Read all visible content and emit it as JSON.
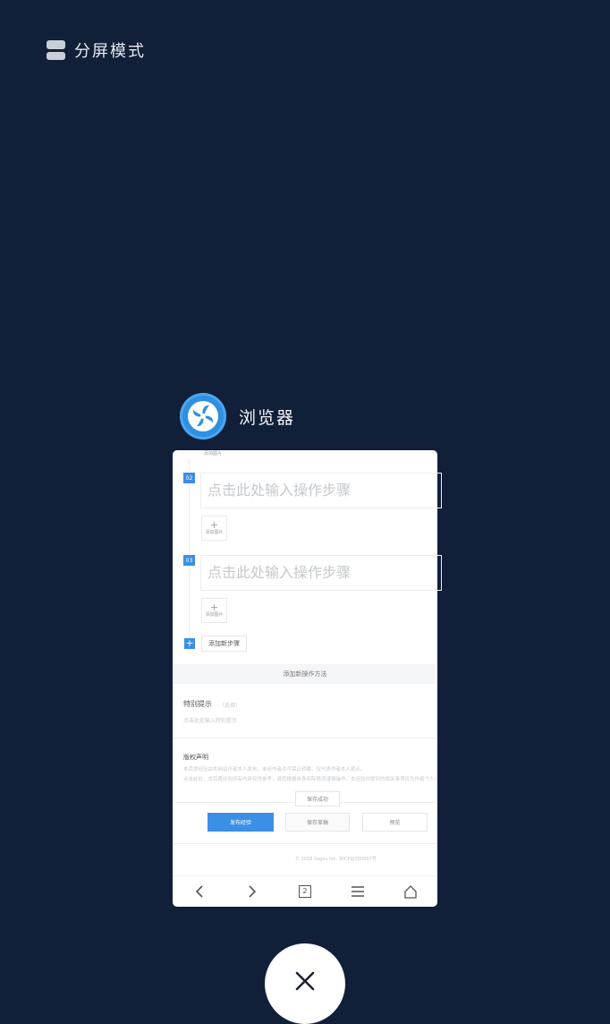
{
  "split_mode": {
    "label": "分屏模式",
    "icon": "split-screen-icon"
  },
  "app": {
    "name": "浏览器",
    "icon": "browser-fan-icon",
    "accent": "#2f8fe0"
  },
  "card": {
    "top_add_image": "添加图片",
    "steps": [
      {
        "number": "02",
        "placeholder": "点击此处输入操作步骤",
        "add_image": "添加图片"
      },
      {
        "number": "03",
        "placeholder": "点击此处输入操作步骤",
        "add_image": "添加图片"
      }
    ],
    "add_step_label": "添加新步骤",
    "add_method_label": "添加新操作方法",
    "tips": {
      "title": "特别提示",
      "note": "（选填）",
      "placeholder": "点击此处输入特别提示"
    },
    "copyright_section": {
      "title": "版权声明",
      "line1": "本百度经验由本网站作者本人发布，未经作者许可禁止转载，仅代表作者本人观点。",
      "line2": "点击此处，本百度经验所有内容仅供参考，请您根据自身实际情况谨慎操作，本经验中提到的相关事项仅为作者个人意见。"
    },
    "toast": "保存成功",
    "actions": {
      "publish": "发布经验",
      "save_draft": "保存草稿",
      "preview": "预览"
    },
    "footer": "© 2018 Sogou Inc. 京ICP证050897号",
    "nav": {
      "tab_count": "2"
    }
  },
  "close": {
    "icon": "close-icon"
  }
}
